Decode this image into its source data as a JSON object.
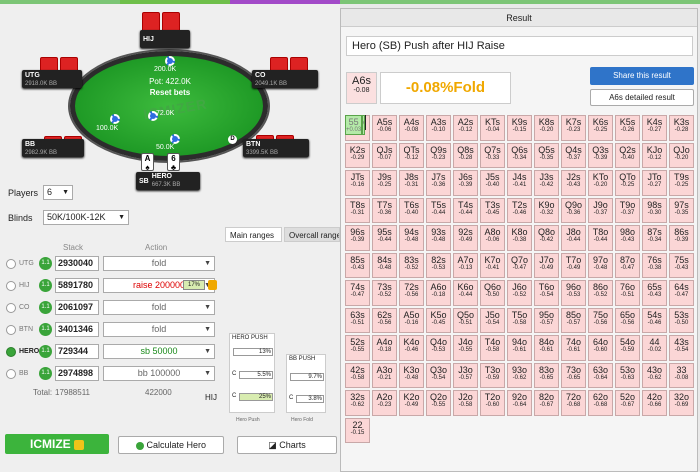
{
  "table": {
    "pot": "Pot: 422.0K",
    "reset": "Reset bets",
    "pot_chip": "72.0K",
    "wm": "ICMIZER",
    "seats": {
      "hij": {
        "name": "HIJ",
        "stack": ""
      },
      "utg": {
        "name": "UTG",
        "stack": "2918.0K BB"
      },
      "co": {
        "name": "CO",
        "stack": "2049.1K BB"
      },
      "bb": {
        "name": "BB",
        "stack": "2982.9K BB"
      },
      "btn": {
        "name": "BTN",
        "stack": "3399.5K BB"
      },
      "sb": {
        "name": "SB",
        "label": "HERO",
        "stack": "667.3K BB"
      }
    },
    "bets": {
      "hij": "200.0K",
      "bb": "100.0K",
      "sb": "50.0K"
    },
    "hero_cards": [
      {
        "rank": "A",
        "suit": "♠"
      },
      {
        "rank": "6",
        "suit": "♣"
      }
    ],
    "dealer": "D"
  },
  "settings": {
    "players_label": "Players",
    "players": "6",
    "blinds_label": "Blinds",
    "blinds": "50K/100K-12K"
  },
  "cols": {
    "stack": "Stack",
    "action": "Action"
  },
  "players": [
    {
      "pos": "UTG",
      "icm": "1.1",
      "stack": "2930040",
      "action": "fold",
      "style": ""
    },
    {
      "pos": "HIJ",
      "icm": "1.1",
      "stack": "5891780",
      "action": "raise 200000",
      "style": "red",
      "pct": "17%"
    },
    {
      "pos": "CO",
      "icm": "1.1",
      "stack": "2061097",
      "action": "fold",
      "style": ""
    },
    {
      "pos": "BTN",
      "icm": "1.1",
      "stack": "3401346",
      "action": "fold",
      "style": ""
    },
    {
      "pos": "HERO",
      "icm": "1.1",
      "stack": "729344",
      "action": "sb 50000",
      "style": "green"
    },
    {
      "pos": "BB",
      "icm": "1.1",
      "stack": "2974898",
      "action": "bb 100000",
      "style": ""
    }
  ],
  "totals": {
    "label": "Total:",
    "stack": "17988511",
    "action": "422000",
    "hij": "HIJ"
  },
  "tabs": {
    "main": "Main ranges",
    "overall": "Overcall ranges"
  },
  "mini": {
    "hero_push": "HERO PUSH",
    "hero_pct": "13%",
    "bb_push": "BB PUSH",
    "bb_pct": "9.7%",
    "c1": "C",
    "c1v": "5.5%",
    "c2": "C",
    "c2v": "3.8%",
    "c3": "C",
    "c3v": "25%",
    "lbl1": "Hero Push",
    "lbl2": "Hero Fold"
  },
  "buttons": {
    "icmize": "ICMIZE",
    "calc": "Calculate Hero",
    "charts": "Charts"
  },
  "result": {
    "header": "Result",
    "title": "Hero (SB) Push after HIJ Raise",
    "hand": "A6s",
    "hand_ev": "-0.08",
    "summary": "-0.08%Fold",
    "share": "Share this result",
    "detailed": "A6s detailed result"
  },
  "grid": [
    [
      [
        "AA",
        "+1.25"
      ],
      [
        "AKs",
        "+0.53"
      ],
      [
        "AQs",
        "+0.43"
      ],
      [
        "AJs",
        "+0.33"
      ],
      [
        "ATs",
        "+0.24"
      ],
      [
        "A9s",
        "+0.11"
      ],
      [
        "A8s",
        "+0.04"
      ],
      [
        "A7s",
        "-0.03"
      ],
      [
        "A6s",
        "-0.08"
      ],
      [
        "A5s",
        "-0.06"
      ],
      [
        "A4s",
        "-0.08"
      ],
      [
        "A3s",
        "-0.10"
      ],
      [
        "A2s",
        "-0.12"
      ]
    ],
    [
      [
        "AKo",
        "+0.47"
      ],
      [
        "KK",
        "+0.94"
      ],
      [
        "KQs",
        "+0.19"
      ],
      [
        "KJs",
        "+0.03"
      ],
      [
        "KTs",
        "-0.04"
      ],
      [
        "K9s",
        "-0.15"
      ],
      [
        "K8s",
        "-0.20"
      ],
      [
        "K7s",
        "-0.23"
      ],
      [
        "K6s",
        "-0.25"
      ],
      [
        "K5s",
        "-0.26"
      ],
      [
        "K4s",
        "-0.27"
      ],
      [
        "K3s",
        "-0.28"
      ],
      [
        "K2s",
        "-0.29"
      ]
    ],
    [
      [
        "AQo",
        "+0.36"
      ],
      [
        "KQo",
        "+0.02"
      ],
      [
        "QQ",
        "+0.78"
      ],
      [
        "QJs",
        "-0.07"
      ],
      [
        "QTs",
        "-0.12"
      ],
      [
        "Q9s",
        "-0.23"
      ],
      [
        "Q8s",
        "-0.28"
      ],
      [
        "Q7s",
        "-0.33"
      ],
      [
        "Q6s",
        "-0.34"
      ],
      [
        "Q5s",
        "-0.35"
      ],
      [
        "Q4s",
        "-0.37"
      ],
      [
        "Q3s",
        "-0.39"
      ],
      [
        "Q2s",
        "-0.40"
      ]
    ],
    [
      [
        "AJo",
        "+0.25"
      ],
      [
        "KJo",
        "-0.12"
      ],
      [
        "QJo",
        "-0.20"
      ],
      [
        "JJ",
        "+0.63"
      ],
      [
        "JTs",
        "-0.16"
      ],
      [
        "J9s",
        "-0.25"
      ],
      [
        "J8s",
        "-0.31"
      ],
      [
        "J7s",
        "-0.36"
      ],
      [
        "J6s",
        "-0.39"
      ],
      [
        "J5s",
        "-0.40"
      ],
      [
        "J4s",
        "-0.41"
      ],
      [
        "J3s",
        "-0.42"
      ],
      [
        "J2s",
        "-0.43"
      ]
    ],
    [
      [
        "ATo",
        "+0.16"
      ],
      [
        "KTo",
        "-0.20"
      ],
      [
        "QTo",
        "-0.25"
      ],
      [
        "JTo",
        "-0.27"
      ],
      [
        "TT",
        "+0.49"
      ],
      [
        "T9s",
        "-0.25"
      ],
      [
        "T8s",
        "-0.31"
      ],
      [
        "T7s",
        "-0.36"
      ],
      [
        "T6s",
        "-0.40"
      ],
      [
        "T5s",
        "-0.44"
      ],
      [
        "T4s",
        "-0.44"
      ],
      [
        "T3s",
        "-0.45"
      ],
      [
        "T2s",
        "-0.46"
      ]
    ],
    [
      [
        "A9o",
        "+0.02"
      ],
      [
        "K9o",
        "-0.32"
      ],
      [
        "Q9o",
        "-0.36"
      ],
      [
        "J9o",
        "-0.37"
      ],
      [
        "T9o",
        "-0.37"
      ],
      [
        "99",
        "+0.35"
      ],
      [
        "98s",
        "-0.30"
      ],
      [
        "97s",
        "-0.35"
      ],
      [
        "96s",
        "-0.39"
      ],
      [
        "95s",
        "-0.44"
      ],
      [
        "94s",
        "-0.48"
      ],
      [
        "93s",
        "-0.48"
      ],
      [
        "92s",
        "-0.49"
      ]
    ],
    [
      [
        "A8o",
        "-0.06"
      ],
      [
        "K8o",
        "-0.38"
      ],
      [
        "Q8o",
        "-0.42"
      ],
      [
        "J8o",
        "-0.44"
      ],
      [
        "T8o",
        "-0.44"
      ],
      [
        "98o",
        "-0.43"
      ],
      [
        "88",
        "+0.24"
      ],
      [
        "87s",
        "-0.34"
      ],
      [
        "86s",
        "-0.39"
      ],
      [
        "85s",
        "-0.43"
      ],
      [
        "84s",
        "-0.48"
      ],
      [
        "83s",
        "-0.52"
      ],
      [
        "82s",
        "-0.53"
      ]
    ],
    [
      [
        "A7o",
        "-0.13"
      ],
      [
        "K7o",
        "-0.41"
      ],
      [
        "Q7o",
        "-0.47"
      ],
      [
        "J7o",
        "-0.49"
      ],
      [
        "T7o",
        "-0.49"
      ],
      [
        "97o",
        "-0.48"
      ],
      [
        "87o",
        "-0.47"
      ],
      [
        "77",
        "+0.15"
      ],
      [
        "76s",
        "-0.38"
      ],
      [
        "75s",
        "-0.43"
      ],
      [
        "74s",
        "-0.47"
      ],
      [
        "73s",
        "-0.52"
      ],
      [
        "72s",
        "-0.56"
      ]
    ],
    [
      [
        "A6o",
        "-0.18"
      ],
      [
        "K6o",
        "-0.44"
      ],
      [
        "Q6o",
        "-0.50"
      ],
      [
        "J6o",
        "-0.52"
      ],
      [
        "T6o",
        "-0.54"
      ],
      [
        "96o",
        "-0.53"
      ],
      [
        "86o",
        "-0.52"
      ],
      [
        "76o",
        "-0.51"
      ],
      [
        "66",
        "+0.09"
      ],
      [
        "65s",
        "-0.43"
      ],
      [
        "64s",
        "-0.47"
      ],
      [
        "63s",
        "-0.51"
      ],
      [
        "62s",
        "-0.56"
      ]
    ],
    [
      [
        "A5o",
        "-0.16"
      ],
      [
        "K5o",
        "-0.45"
      ],
      [
        "Q5o",
        "-0.51"
      ],
      [
        "J5o",
        "-0.54"
      ],
      [
        "T5o",
        "-0.58"
      ],
      [
        "95o",
        "-0.57"
      ],
      [
        "85o",
        "-0.57"
      ],
      [
        "75o",
        "-0.56"
      ],
      [
        "65o",
        "-0.56"
      ],
      [
        "55",
        "+0.03"
      ],
      [
        "54s",
        "-0.46"
      ],
      [
        "53s",
        "-0.50"
      ],
      [
        "52s",
        "-0.55"
      ]
    ],
    [
      [
        "A4o",
        "-0.18"
      ],
      [
        "K4o",
        "-0.46"
      ],
      [
        "Q4o",
        "-0.53"
      ],
      [
        "J4o",
        "-0.55"
      ],
      [
        "T4o",
        "-0.58"
      ],
      [
        "94o",
        "-0.61"
      ],
      [
        "84o",
        "-0.61"
      ],
      [
        "74o",
        "-0.61"
      ],
      [
        "64o",
        "-0.60"
      ],
      [
        "54o",
        "-0.59"
      ],
      [
        "44",
        "-0.02"
      ],
      [
        "43s",
        "-0.54"
      ],
      [
        "42s",
        "-0.58"
      ]
    ],
    [
      [
        "A3o",
        "-0.21"
      ],
      [
        "K3o",
        "-0.48"
      ],
      [
        "Q3o",
        "-0.54"
      ],
      [
        "J3o",
        "-0.57"
      ],
      [
        "T3o",
        "-0.59"
      ],
      [
        "93o",
        "-0.62"
      ],
      [
        "83o",
        "-0.65"
      ],
      [
        "73o",
        "-0.65"
      ],
      [
        "63o",
        "-0.64"
      ],
      [
        "53o",
        "-0.63"
      ],
      [
        "43o",
        "-0.62"
      ],
      [
        "33",
        "-0.08"
      ],
      [
        "32s",
        "-0.62"
      ]
    ],
    [
      [
        "A2o",
        "-0.23"
      ],
      [
        "K2o",
        "-0.49"
      ],
      [
        "Q2o",
        "-0.55"
      ],
      [
        "J2o",
        "-0.58"
      ],
      [
        "T2o",
        "-0.60"
      ],
      [
        "92o",
        "-0.64"
      ],
      [
        "82o",
        "-0.67"
      ],
      [
        "72o",
        "-0.68"
      ],
      [
        "62o",
        "-0.68"
      ],
      [
        "52o",
        "-0.67"
      ],
      [
        "42o",
        "-0.66"
      ],
      [
        "32o",
        "-0.69"
      ],
      [
        "22",
        "-0.15"
      ]
    ]
  ]
}
